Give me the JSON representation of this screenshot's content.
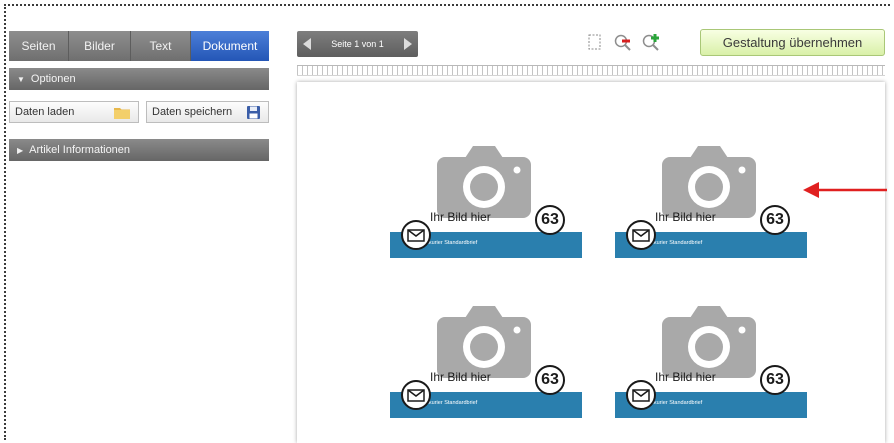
{
  "sidebar": {
    "tabs": [
      {
        "label": "Seiten",
        "active": false
      },
      {
        "label": "Bilder",
        "active": false
      },
      {
        "label": "Text",
        "active": false
      },
      {
        "label": "Dokument",
        "active": true
      }
    ],
    "options_section": {
      "label": "Optionen",
      "expanded": true
    },
    "load_button": {
      "label": "Daten laden",
      "icon": "folder-icon"
    },
    "save_button": {
      "label": "Daten speichern",
      "icon": "floppy-disk-icon"
    },
    "article_section": {
      "label": "Artikel Informationen",
      "expanded": false
    }
  },
  "toolbar": {
    "pager_label": "Seite 1 von 1",
    "tools": [
      "page-frame-icon",
      "zoom-out-icon",
      "zoom-in-icon"
    ],
    "apply_button": "Gestaltung übernehmen"
  },
  "labels": [
    {
      "placeholder": "Ihr Bild hier",
      "number": "63",
      "band_text": "Nordkurier Standardbrief"
    },
    {
      "placeholder": "Ihr Bild hier",
      "number": "63",
      "band_text": "Nordkurier Standardbrief"
    },
    {
      "placeholder": "Ihr Bild hier",
      "number": "63",
      "band_text": "Nordkurier Standardbrief"
    },
    {
      "placeholder": "Ihr Bild hier",
      "number": "63",
      "band_text": "Nordkurier Standardbrief"
    }
  ],
  "colors": {
    "active_tab": "#2f63c4",
    "apply_button": "#e6f5bd",
    "label_band": "#2a7fae",
    "camera": "#a9a9a9",
    "annotation_arrow": "#e02020"
  }
}
